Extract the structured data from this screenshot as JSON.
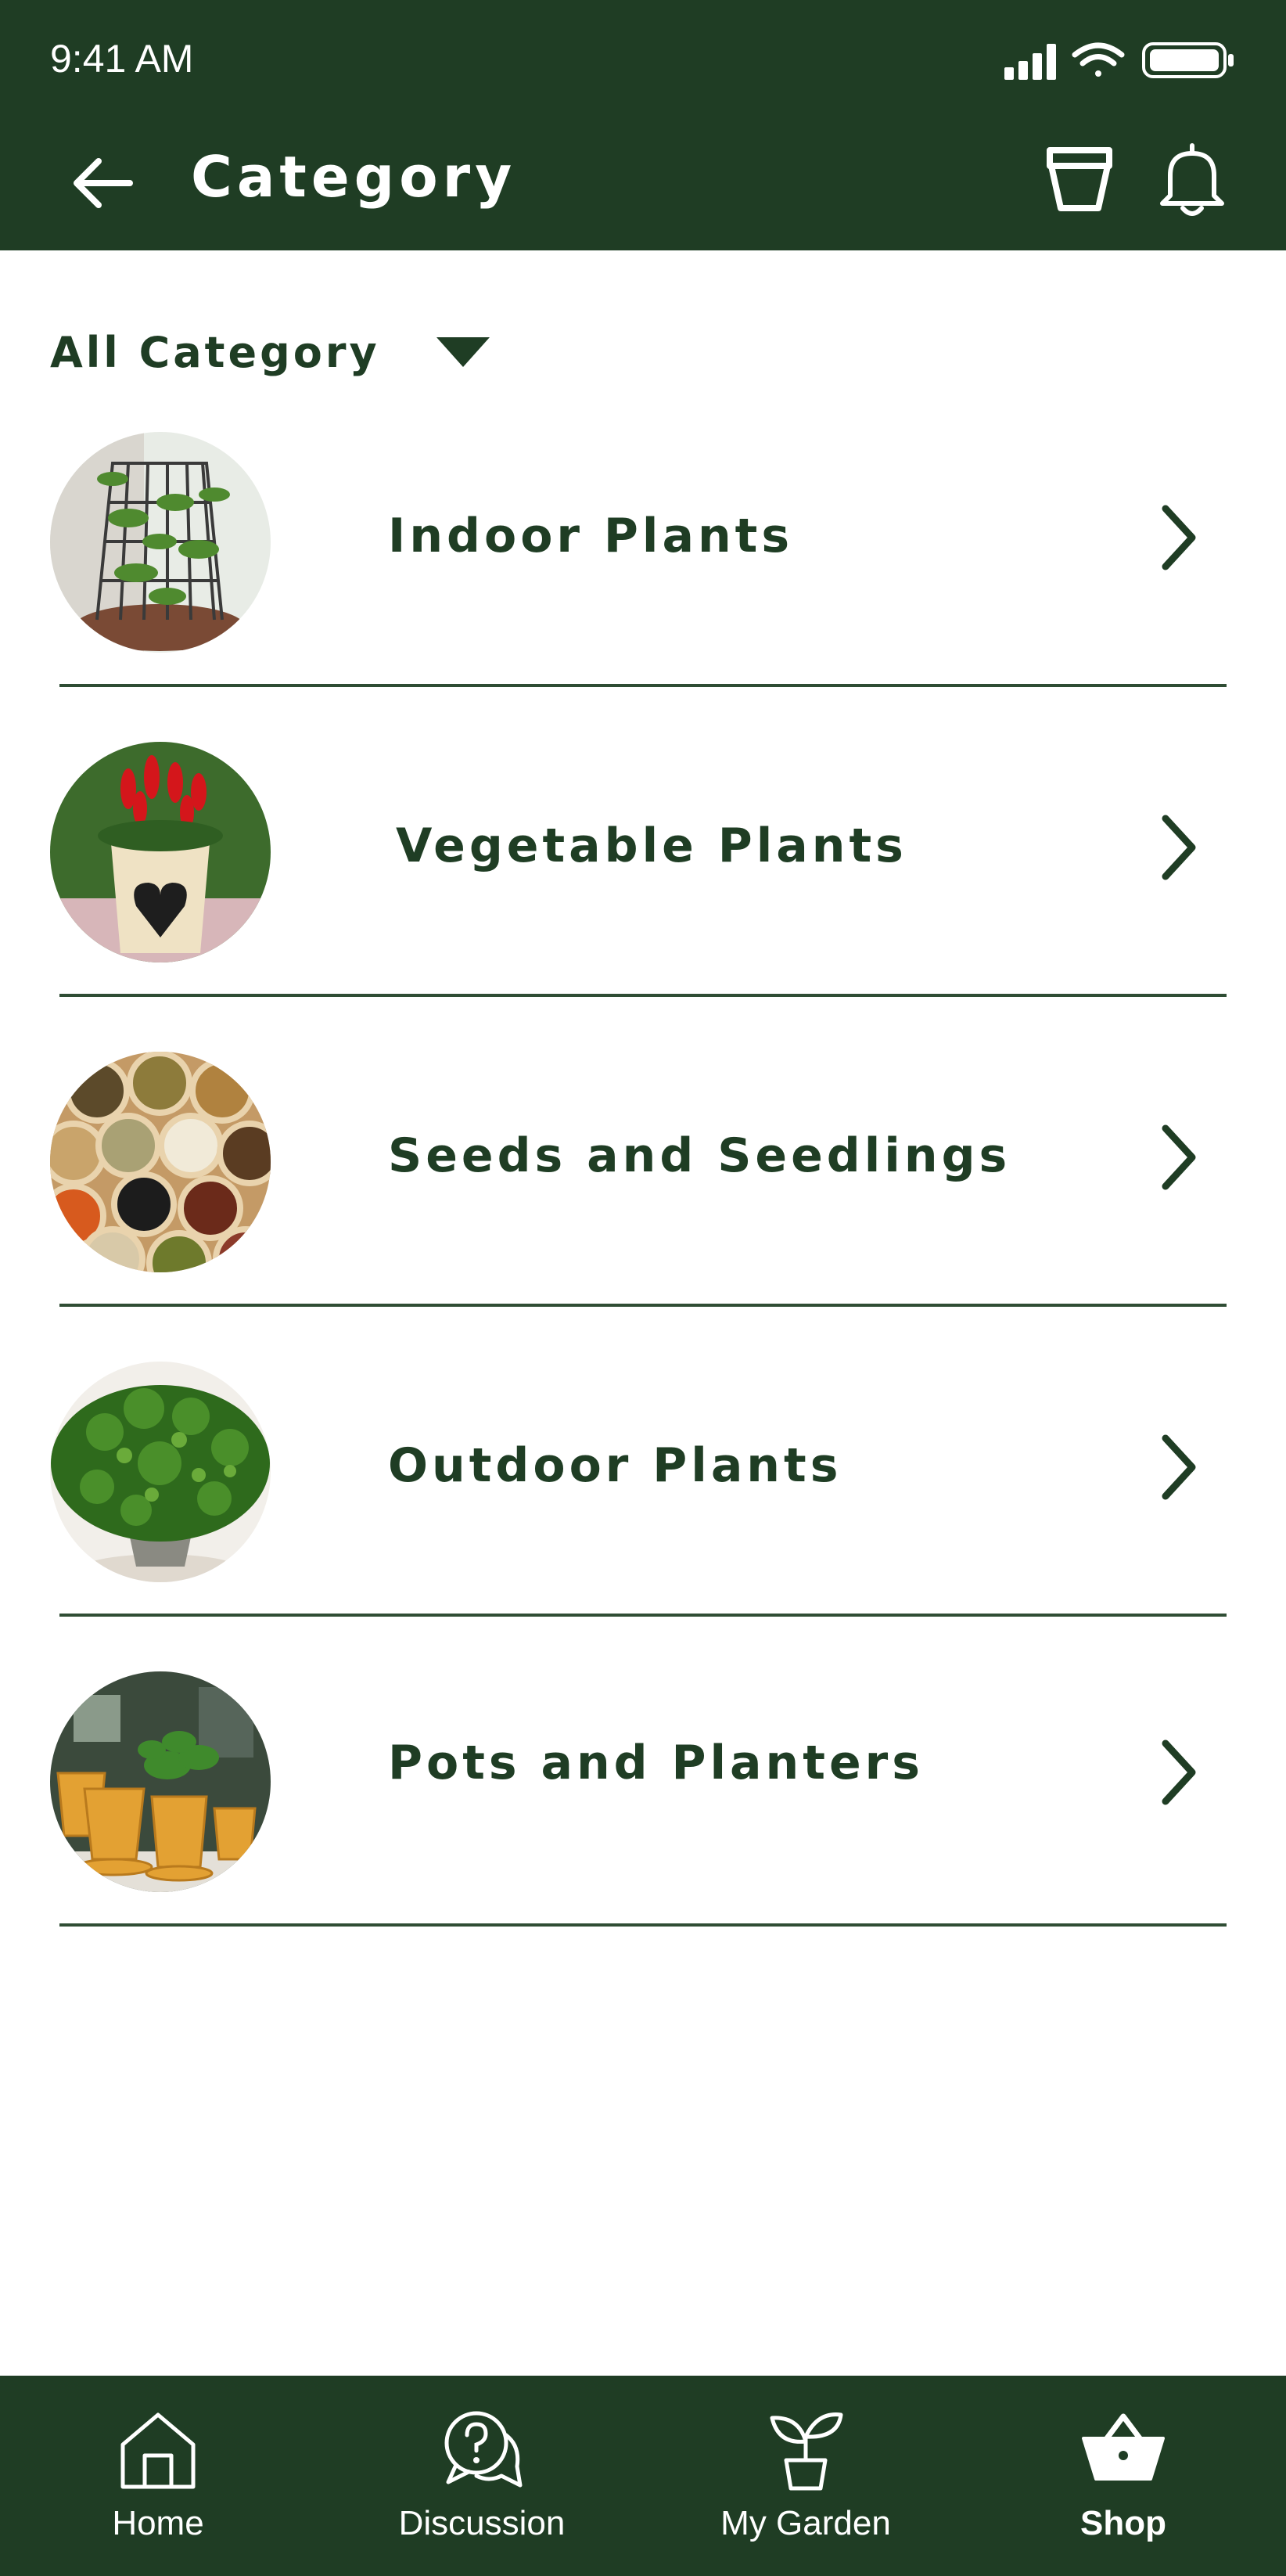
{
  "status_bar": {
    "time": "9:41 AM"
  },
  "header": {
    "title": "Category"
  },
  "filter": {
    "label": "All Category"
  },
  "categories": [
    {
      "label": "Indoor Plants",
      "image": "indoor-plants-photo"
    },
    {
      "label": "Vegetable Plants",
      "image": "vegetable-plants-photo"
    },
    {
      "label": "Seeds and Seedlings",
      "image": "seeds-photo"
    },
    {
      "label": "Outdoor Plants",
      "image": "outdoor-plants-photo"
    },
    {
      "label": "Pots and Planters",
      "image": "pots-photo"
    }
  ],
  "bottom_nav": [
    {
      "label": "Home",
      "icon": "home-icon",
      "active": false
    },
    {
      "label": "Discussion",
      "icon": "discussion-icon",
      "active": false
    },
    {
      "label": "My Garden",
      "icon": "sprout-icon",
      "active": false
    },
    {
      "label": "Shop",
      "icon": "shop-basket-icon",
      "active": true
    }
  ],
  "colors": {
    "primary": "#1f3d24",
    "background": "#ffffff",
    "divider": "#2f4d34"
  }
}
